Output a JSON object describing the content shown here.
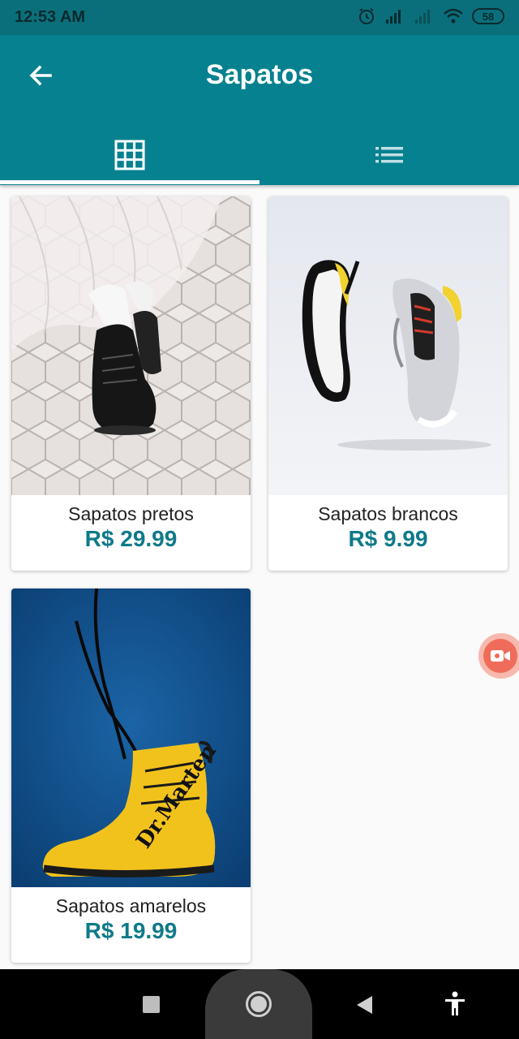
{
  "status_bar": {
    "time": "12:53 AM",
    "battery": "58",
    "icons": [
      "alarm-icon",
      "signal-icon",
      "signal-weak-icon",
      "wifi-icon",
      "battery-icon"
    ]
  },
  "app_bar": {
    "title": "Sapatos",
    "back_icon": "arrow-left-icon",
    "tabs": [
      {
        "icon": "grid-icon",
        "selected": true
      },
      {
        "icon": "list-icon",
        "selected": false
      }
    ],
    "color": "#068190"
  },
  "products": [
    {
      "name": "Sapatos pretos",
      "price": "R$ 29.99",
      "image": "black-boots-photo"
    },
    {
      "name": "Sapatos brancos",
      "price": "R$ 9.99",
      "image": "white-sneakers-photo"
    },
    {
      "name": "Sapatos amarelos",
      "price": "R$ 19.99",
      "image": "yellow-boot-photo"
    }
  ],
  "fab": {
    "icon": "video-camera-icon",
    "color": "#f06c5a"
  },
  "nav_bar": {
    "icons": [
      "recents-square-icon",
      "home-circle-icon",
      "back-triangle-icon",
      "accessibility-icon"
    ]
  },
  "colors": {
    "accent": "#068190",
    "price": "#0e7a88"
  }
}
